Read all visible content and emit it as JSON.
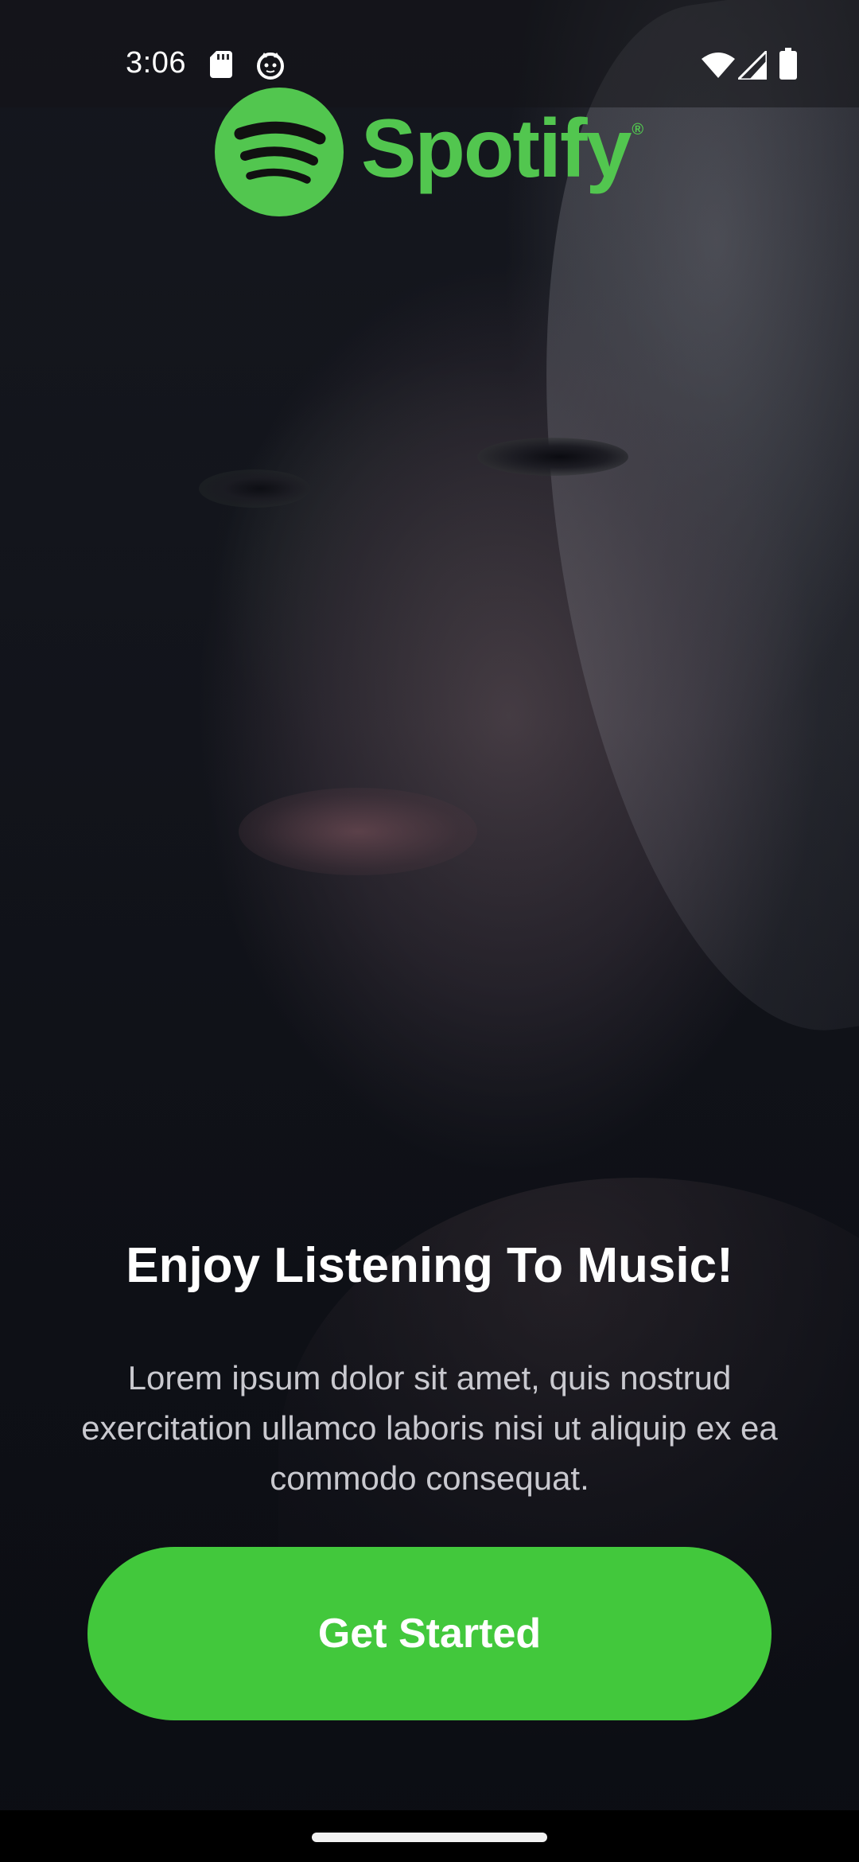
{
  "status_bar": {
    "time": "3:06",
    "icons": [
      "sd-card-icon",
      "cat-notification-icon",
      "wifi-icon",
      "signal-icon",
      "battery-icon"
    ]
  },
  "logo": {
    "wordmark": "Spotify",
    "registered": "®",
    "color": "#52c64f"
  },
  "main": {
    "headline": "Enjoy Listening To Music!",
    "description": "Lorem ipsum dolor sit amet, quis nostrud exercitation ullamco laboris nisi ut aliquip ex ea commodo consequat.",
    "cta_label": "Get Started",
    "cta_color": "#42c83c"
  }
}
